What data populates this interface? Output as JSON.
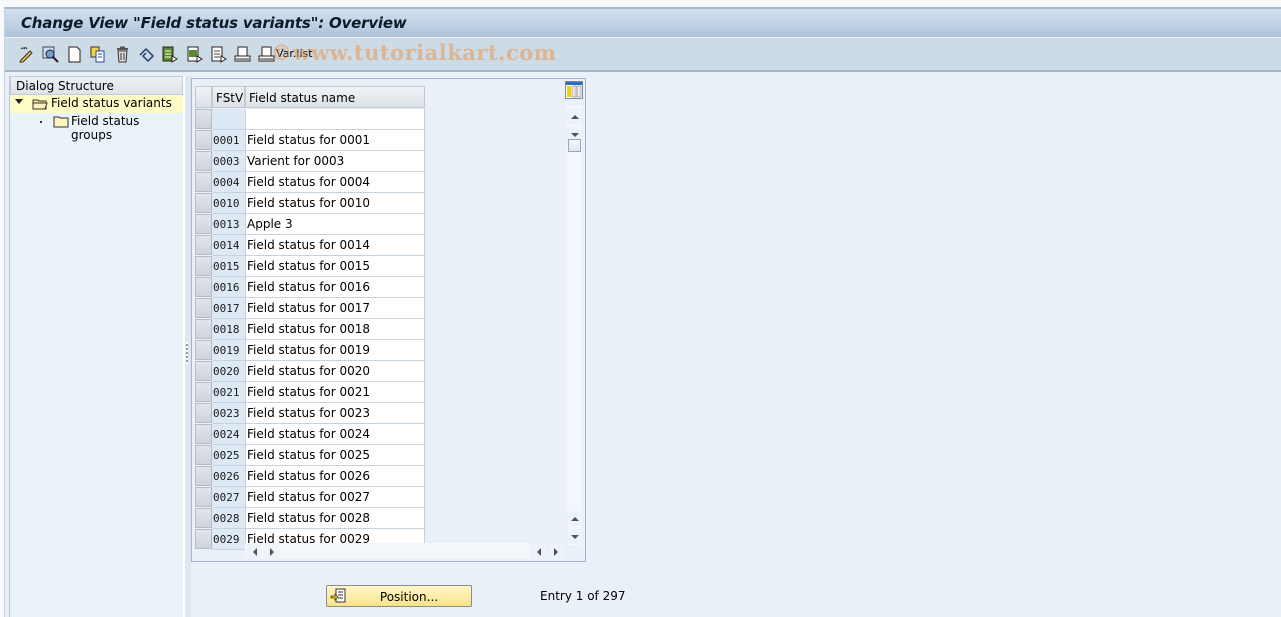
{
  "window": {
    "title": "Change View \"Field status variants\": Overview"
  },
  "toolbar": {
    "buttons": [
      {
        "icon": "display-change-icon",
        "label": ""
      },
      {
        "icon": "find-icon",
        "label": ""
      },
      {
        "icon": "new-entries-icon",
        "label": ""
      },
      {
        "icon": "copy-as-icon",
        "label": ""
      },
      {
        "icon": "delete-icon",
        "label": ""
      },
      {
        "icon": "undo-change-icon",
        "label": ""
      },
      {
        "icon": "select-all-icon",
        "label": ""
      },
      {
        "icon": "select-block-icon",
        "label": ""
      },
      {
        "icon": "deselect-all-icon",
        "label": ""
      },
      {
        "icon": "print-icon",
        "label": ""
      },
      {
        "icon": "print-icon",
        "label": "Var.list"
      }
    ],
    "varlist_label": "Var.list"
  },
  "watermark": "©www.tutorialkart.com",
  "dialog_structure": {
    "header": "Dialog Structure",
    "items": [
      {
        "label": "Field status variants",
        "level": 0,
        "selected": true,
        "expanded": true,
        "icon": "open-folder-icon"
      },
      {
        "label": "Field status groups",
        "level": 1,
        "selected": false,
        "expanded": false,
        "icon": "folder-icon"
      }
    ]
  },
  "table": {
    "columns": [
      "FStV",
      "Field status name"
    ],
    "rows": [
      {
        "key": "",
        "name": ""
      },
      {
        "key": "0001",
        "name": "Field status for 0001"
      },
      {
        "key": "0003",
        "name": "Varient for 0003"
      },
      {
        "key": "0004",
        "name": "Field status for 0004"
      },
      {
        "key": "0010",
        "name": "Field status for 0010"
      },
      {
        "key": "0013",
        "name": "Apple 3"
      },
      {
        "key": "0014",
        "name": "Field status for 0014"
      },
      {
        "key": "0015",
        "name": "Field status for 0015"
      },
      {
        "key": "0016",
        "name": "Field status for 0016"
      },
      {
        "key": "0017",
        "name": "Field status for 0017"
      },
      {
        "key": "0018",
        "name": "Field status for 0018"
      },
      {
        "key": "0019",
        "name": "Field status for 0019"
      },
      {
        "key": "0020",
        "name": "Field status for 0020"
      },
      {
        "key": "0021",
        "name": "Field status for 0021"
      },
      {
        "key": "0023",
        "name": "Field status for 0023"
      },
      {
        "key": "0024",
        "name": "Field status for 0024"
      },
      {
        "key": "0025",
        "name": "Field status for 0025"
      },
      {
        "key": "0026",
        "name": "Field status for 0026"
      },
      {
        "key": "0027",
        "name": "Field status for 0027"
      },
      {
        "key": "0028",
        "name": "Field status for 0028"
      },
      {
        "key": "0029",
        "name": "Field status for 0029"
      }
    ]
  },
  "footer": {
    "position_label": "Position...",
    "entry_text": "Entry 1 of 297"
  },
  "colors": {
    "title_gradient_top": "#d4e1ef",
    "title_gradient_bottom": "#aec3da",
    "toolbar_bg": "#cddbe6",
    "content_bg": "#e9f0f7",
    "tree_selected_bg": "#fdfcc5",
    "key_cell_bg": "#dde9f4",
    "position_button_bg": "#f8e38a"
  }
}
